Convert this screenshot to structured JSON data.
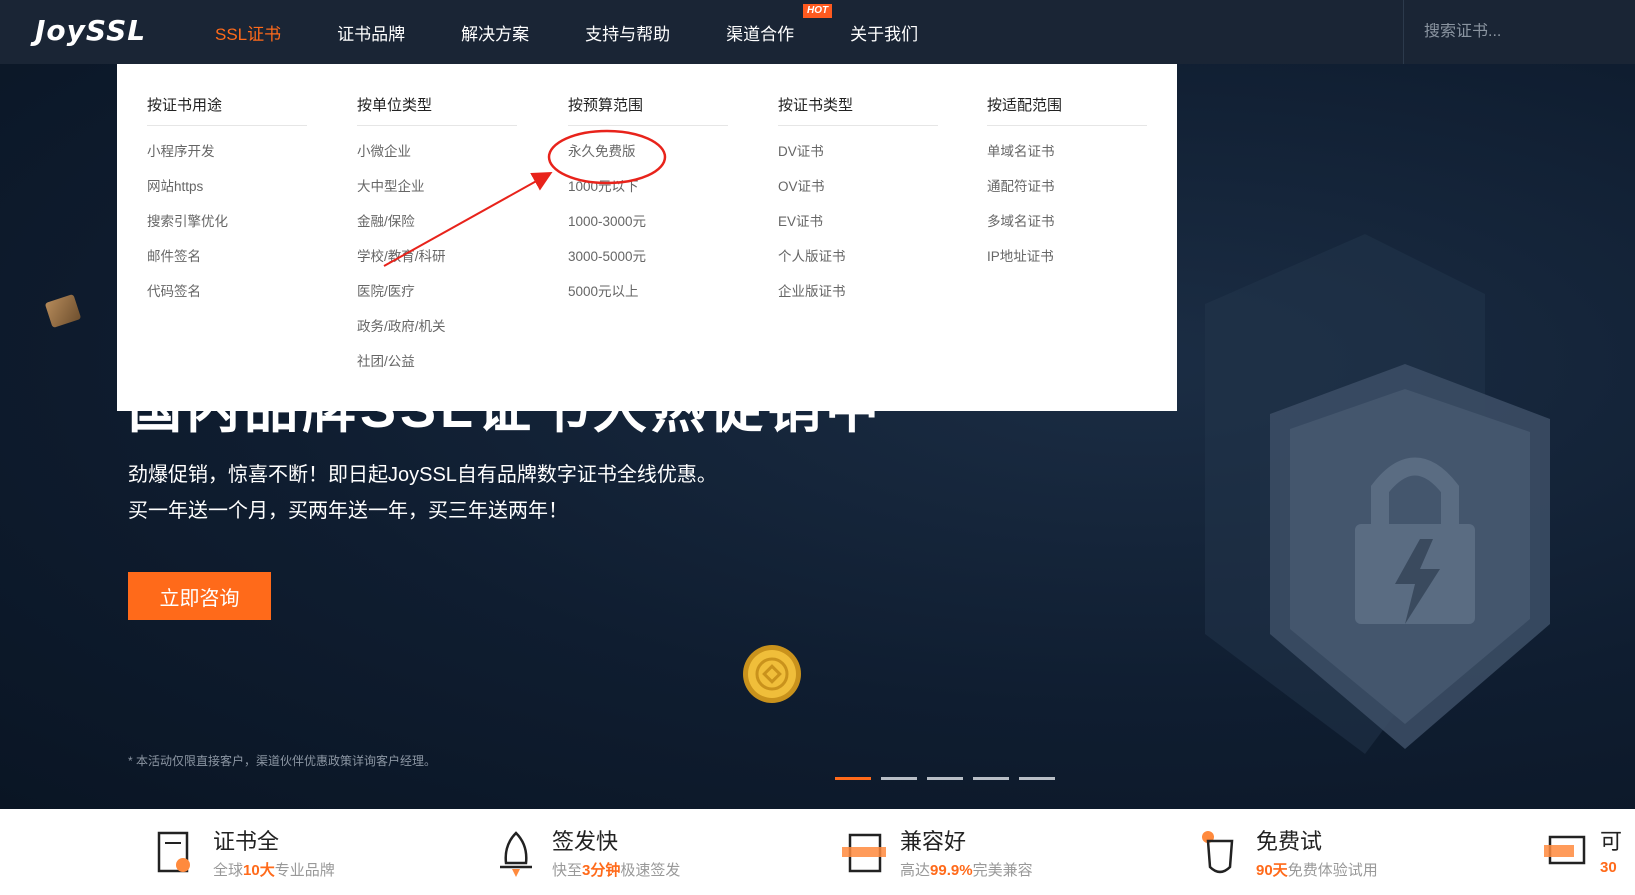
{
  "header": {
    "logo": "JoySSL",
    "nav": [
      {
        "label": "SSL证书",
        "active": true
      },
      {
        "label": "证书品牌"
      },
      {
        "label": "解决方案"
      },
      {
        "label": "支持与帮助"
      },
      {
        "label": "渠道合作",
        "badge": "HOT"
      },
      {
        "label": "关于我们"
      }
    ],
    "search_placeholder": "搜索证书..."
  },
  "dropdown": {
    "columns": [
      {
        "heading": "按证书用途",
        "items": [
          "小程序开发",
          "网站https",
          "搜索引擎优化",
          "邮件签名",
          "代码签名"
        ]
      },
      {
        "heading": "按单位类型",
        "items": [
          "小微企业",
          "大中型企业",
          "金融/保险",
          "学校/教育/科研",
          "医院/医疗",
          "政务/政府/机关",
          "社团/公益"
        ]
      },
      {
        "heading": "按预算范围",
        "items": [
          "永久免费版",
          "1000元以下",
          "1000-3000元",
          "3000-5000元",
          "5000元以上"
        ]
      },
      {
        "heading": "按证书类型",
        "items": [
          "DV证书",
          "OV证书",
          "EV证书",
          "个人版证书",
          "企业版证书"
        ]
      },
      {
        "heading": "按适配范围",
        "items": [
          "单域名证书",
          "通配符证书",
          "多域名证书",
          "IP地址证书"
        ]
      }
    ],
    "annotation_color": "#e8231b"
  },
  "hero": {
    "title": "国内品牌SSL证书大热促销中",
    "desc_line1": "劲爆促销，惊喜不断！即日起JoySSL自有品牌数字证书全线优惠。",
    "desc_line2": "买一年送一个月，买两年送一年，买三年送两年！",
    "cta": "立即咨询",
    "note": "* 本活动仅限直接客户，渠道伙伴优惠政策详询客户经理。",
    "slides": 5,
    "active_slide": 0
  },
  "features": [
    {
      "title": "证书全",
      "sub_pre": "全球",
      "sub_hl": "10大",
      "sub_post": "专业品牌"
    },
    {
      "title": "签发快",
      "sub_pre": "快至",
      "sub_hl": "3分钟",
      "sub_post": "极速签发"
    },
    {
      "title": "兼容好",
      "sub_pre": "高达",
      "sub_hl": "99.9%",
      "sub_post": "完美兼容"
    },
    {
      "title": "免费试",
      "sub_pre": "",
      "sub_hl": "90天",
      "sub_post": "免费体验试用"
    },
    {
      "title": "可",
      "sub_pre": "",
      "sub_hl": "30",
      "sub_post": ""
    }
  ],
  "colors": {
    "accent": "#ff6a1a",
    "header_bg": "#1a2535",
    "hero_bg": "#0f1d30"
  }
}
